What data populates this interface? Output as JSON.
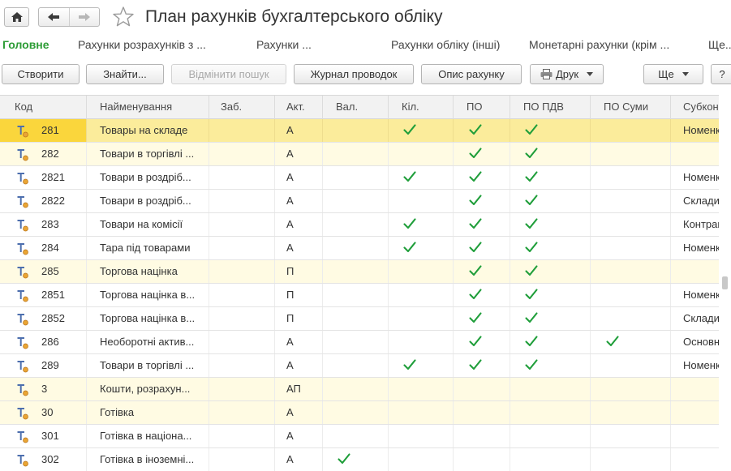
{
  "window": {
    "title": "План рахунків бухгалтерського обліку",
    "icons": {
      "home": "home-icon",
      "back": "arrow-left-icon",
      "forward": "arrow-right-icon",
      "favorite": "star-icon"
    }
  },
  "sections": [
    {
      "label": "Головне",
      "active": true
    },
    {
      "label": "Рахунки розрахунків з ..."
    },
    {
      "label": "Рахунки ..."
    },
    {
      "label": "Рахунки обліку (інші)"
    },
    {
      "label": "Монетарні рахунки (крім ..."
    },
    {
      "label": "Ще..."
    }
  ],
  "toolbar": {
    "create": "Створити",
    "find": "Знайти...",
    "cancel_search": "Відмінити пошук",
    "journal": "Журнал проводок",
    "description": "Опис рахунку",
    "print": "Друк",
    "more": "Ще",
    "help": "?"
  },
  "table": {
    "columns": [
      "Код",
      "Найменування",
      "Заб.",
      "Акт.",
      "Вал.",
      "Кіл.",
      "ПО",
      "ПО ПДВ",
      "ПО Суми",
      "Субкон"
    ],
    "rows": [
      {
        "code": "281",
        "name": "Товары на складе",
        "act": "А",
        "val": false,
        "kil": true,
        "po": true,
        "popdv": true,
        "posumy": false,
        "subkonto": "Номенк",
        "group": false,
        "selected": true
      },
      {
        "code": "282",
        "name": "Товари в торгівлі ...",
        "act": "А",
        "val": false,
        "kil": false,
        "po": true,
        "popdv": true,
        "posumy": false,
        "subkonto": "",
        "group": true
      },
      {
        "code": "2821",
        "name": "Товари в роздріб...",
        "act": "А",
        "val": false,
        "kil": true,
        "po": true,
        "popdv": true,
        "posumy": false,
        "subkonto": "Номенк",
        "group": false
      },
      {
        "code": "2822",
        "name": "Товари в роздріб...",
        "act": "А",
        "val": false,
        "kil": false,
        "po": true,
        "popdv": true,
        "posumy": false,
        "subkonto": "Склади",
        "group": false
      },
      {
        "code": "283",
        "name": "Товари на комісії",
        "act": "А",
        "val": false,
        "kil": true,
        "po": true,
        "popdv": true,
        "posumy": false,
        "subkonto": "Контраг",
        "group": false
      },
      {
        "code": "284",
        "name": "Тара під товарами",
        "act": "А",
        "val": false,
        "kil": true,
        "po": true,
        "popdv": true,
        "posumy": false,
        "subkonto": "Номенк",
        "group": false
      },
      {
        "code": "285",
        "name": "Торгова націнка",
        "act": "П",
        "val": false,
        "kil": false,
        "po": true,
        "popdv": true,
        "posumy": false,
        "subkonto": "",
        "group": true
      },
      {
        "code": "2851",
        "name": "Торгова націнка в...",
        "act": "П",
        "val": false,
        "kil": false,
        "po": true,
        "popdv": true,
        "posumy": false,
        "subkonto": "Номенк",
        "group": false
      },
      {
        "code": "2852",
        "name": "Торгова націнка в...",
        "act": "П",
        "val": false,
        "kil": false,
        "po": true,
        "popdv": true,
        "posumy": false,
        "subkonto": "Склади",
        "group": false
      },
      {
        "code": "286",
        "name": "Необоротні актив...",
        "act": "А",
        "val": false,
        "kil": false,
        "po": true,
        "popdv": true,
        "posumy": true,
        "subkonto": "Основн",
        "group": false
      },
      {
        "code": "289",
        "name": "Товари в торгівлі ...",
        "act": "А",
        "val": false,
        "kil": true,
        "po": true,
        "popdv": true,
        "posumy": false,
        "subkonto": "Номенк",
        "group": false
      },
      {
        "code": "3",
        "name": "Кошти, розрахун...",
        "act": "АП",
        "val": false,
        "kil": false,
        "po": false,
        "popdv": false,
        "posumy": false,
        "subkonto": "",
        "group": true
      },
      {
        "code": "30",
        "name": "Готівка",
        "act": "А",
        "val": false,
        "kil": false,
        "po": false,
        "popdv": false,
        "posumy": false,
        "subkonto": "",
        "group": true
      },
      {
        "code": "301",
        "name": "Готівка в націона...",
        "act": "А",
        "val": false,
        "kil": false,
        "po": false,
        "popdv": false,
        "posumy": false,
        "subkonto": "",
        "group": false
      },
      {
        "code": "302",
        "name": "Готівка в іноземні...",
        "act": "А",
        "val": true,
        "kil": false,
        "po": false,
        "popdv": false,
        "posumy": false,
        "subkonto": "",
        "group": false
      }
    ]
  },
  "colors": {
    "accent_green": "#2d9c36",
    "checkmark": "#1f9e3a",
    "selected_row": "#fbec9b",
    "selected_cell": "#fad63c",
    "group_row": "#fffbe3"
  }
}
